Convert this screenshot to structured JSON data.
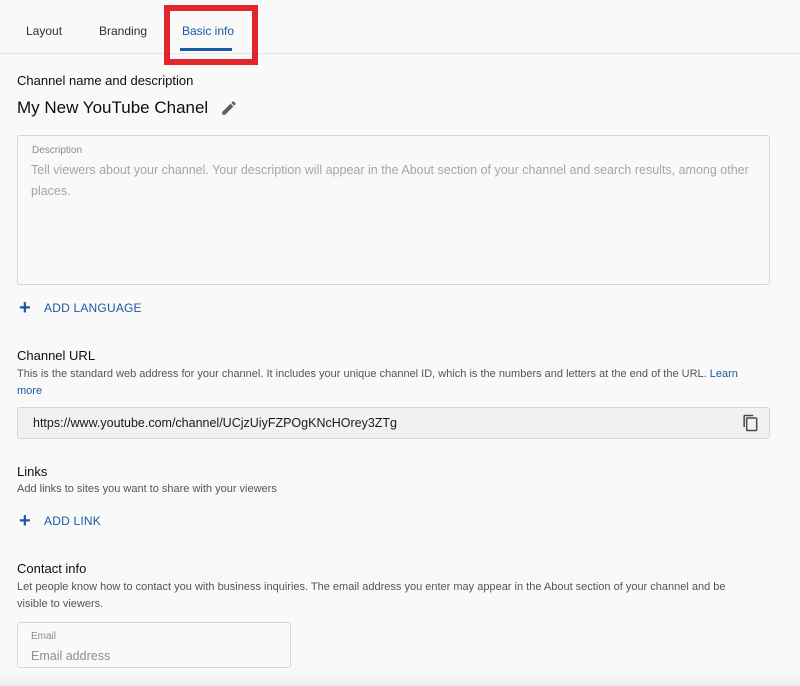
{
  "tabs": [
    {
      "label": "Layout"
    },
    {
      "label": "Branding"
    },
    {
      "label": "Basic info"
    }
  ],
  "channel": {
    "section_title": "Channel name and description",
    "name": "My New YouTube Chanel",
    "description_label": "Description",
    "description_placeholder": "Tell viewers about your channel. Your description will appear in the About section of your channel and search results, among other places.",
    "description_value": ""
  },
  "add_language": {
    "label": "ADD LANGUAGE"
  },
  "channel_url": {
    "title": "Channel URL",
    "description": "This is the standard web address for your channel. It includes your unique channel ID, which is the numbers and letters at the end of the URL.",
    "learn_more": "Learn more",
    "value": "https://www.youtube.com/channel/UCjzUiyFZPOgKNcHOrey3ZTg"
  },
  "links": {
    "title": "Links",
    "description": "Add links to sites you want to share with your viewers",
    "add_label": "ADD LINK"
  },
  "contact": {
    "title": "Contact info",
    "description": "Let people know how to contact you with business inquiries. The email address you enter may appear in the About section of your channel and be visible to viewers.",
    "email_label": "Email",
    "email_placeholder": "Email address",
    "email_value": ""
  },
  "colors": {
    "accent": "#1a5aa3",
    "highlight": "#e3262b"
  },
  "icons": {
    "edit": "pencil-icon",
    "copy": "copy-icon",
    "add": "plus-icon"
  }
}
